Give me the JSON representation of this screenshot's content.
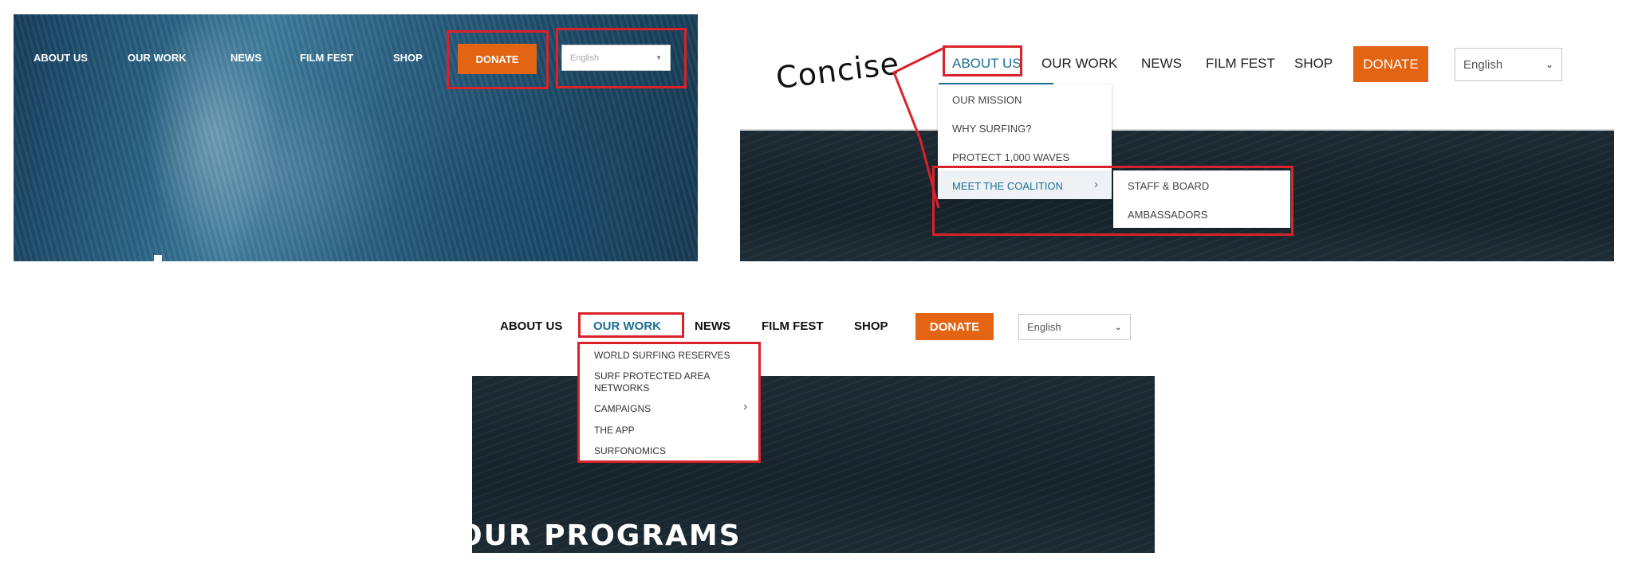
{
  "colors": {
    "accent_red": "#d9222a",
    "donate_orange": "#e36513",
    "link_teal": "#1a6f95",
    "ocean_dark": "#1a2c38"
  },
  "panel1": {
    "nav": [
      "ABOUT US",
      "OUR WORK",
      "NEWS",
      "FILM FEST",
      "SHOP"
    ],
    "donate_label": "DONATE",
    "language_value": "English"
  },
  "panel2": {
    "annotation": "Concise",
    "nav": [
      "ABOUT US",
      "OUR WORK",
      "NEWS",
      "FILM FEST",
      "SHOP"
    ],
    "donate_label": "DONATE",
    "language_value": "English",
    "about_menu": [
      "OUR MISSION",
      "WHY SURFING?",
      "PROTECT 1,000 WAVES",
      "MEET THE COALITION"
    ],
    "coalition_submenu": [
      "STAFF & BOARD",
      "AMBASSADORS"
    ]
  },
  "panel3": {
    "nav": [
      "ABOUT US",
      "OUR WORK",
      "NEWS",
      "FILM FEST",
      "SHOP"
    ],
    "donate_label": "DONATE",
    "language_value": "English",
    "work_menu": [
      "WORLD SURFING RESERVES",
      "SURF PROTECTED AREA NETWORKS",
      "CAMPAIGNS",
      "THE APP",
      "SURFONOMICS"
    ],
    "hero_heading": "OUR PROGRAMS"
  }
}
